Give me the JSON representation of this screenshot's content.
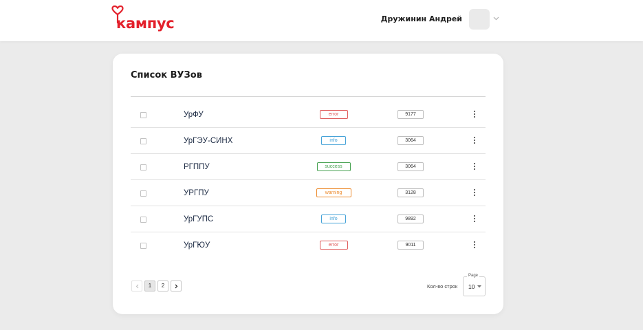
{
  "header": {
    "logo_text": "кампус",
    "user_name": "Дружинин Андрей",
    "brand_color": "#e3202b",
    "icons": {
      "logo": "heart-logo-icon",
      "user_menu": "chevron-down-icon"
    }
  },
  "card": {
    "title": "Список ВУЗов",
    "rows": [
      {
        "name": "УрФУ",
        "status": "error",
        "count": "9177"
      },
      {
        "name": "УрГЭУ-СИНХ",
        "status": "info",
        "count": "3064"
      },
      {
        "name": "РГППУ",
        "status": "success",
        "count": "3064"
      },
      {
        "name": "УРГПУ",
        "status": "warning",
        "count": "3128"
      },
      {
        "name": "УрГУПС",
        "status": "info",
        "count": "9892"
      },
      {
        "name": "УрГЮУ",
        "status": "error",
        "count": "9011"
      }
    ],
    "status_colors": {
      "error": "#e05a5a",
      "info": "#46a3d8",
      "success": "#4aa354",
      "warning": "#ec8a2c"
    }
  },
  "pagination": {
    "prev_icon": "chevron-left-icon",
    "pages": [
      "1",
      "2"
    ],
    "current_page": "1",
    "next_icon": "chevron-right-icon",
    "rows_label": "Кол-во строк",
    "page_size_legend": "Page",
    "page_size_value": "10"
  }
}
